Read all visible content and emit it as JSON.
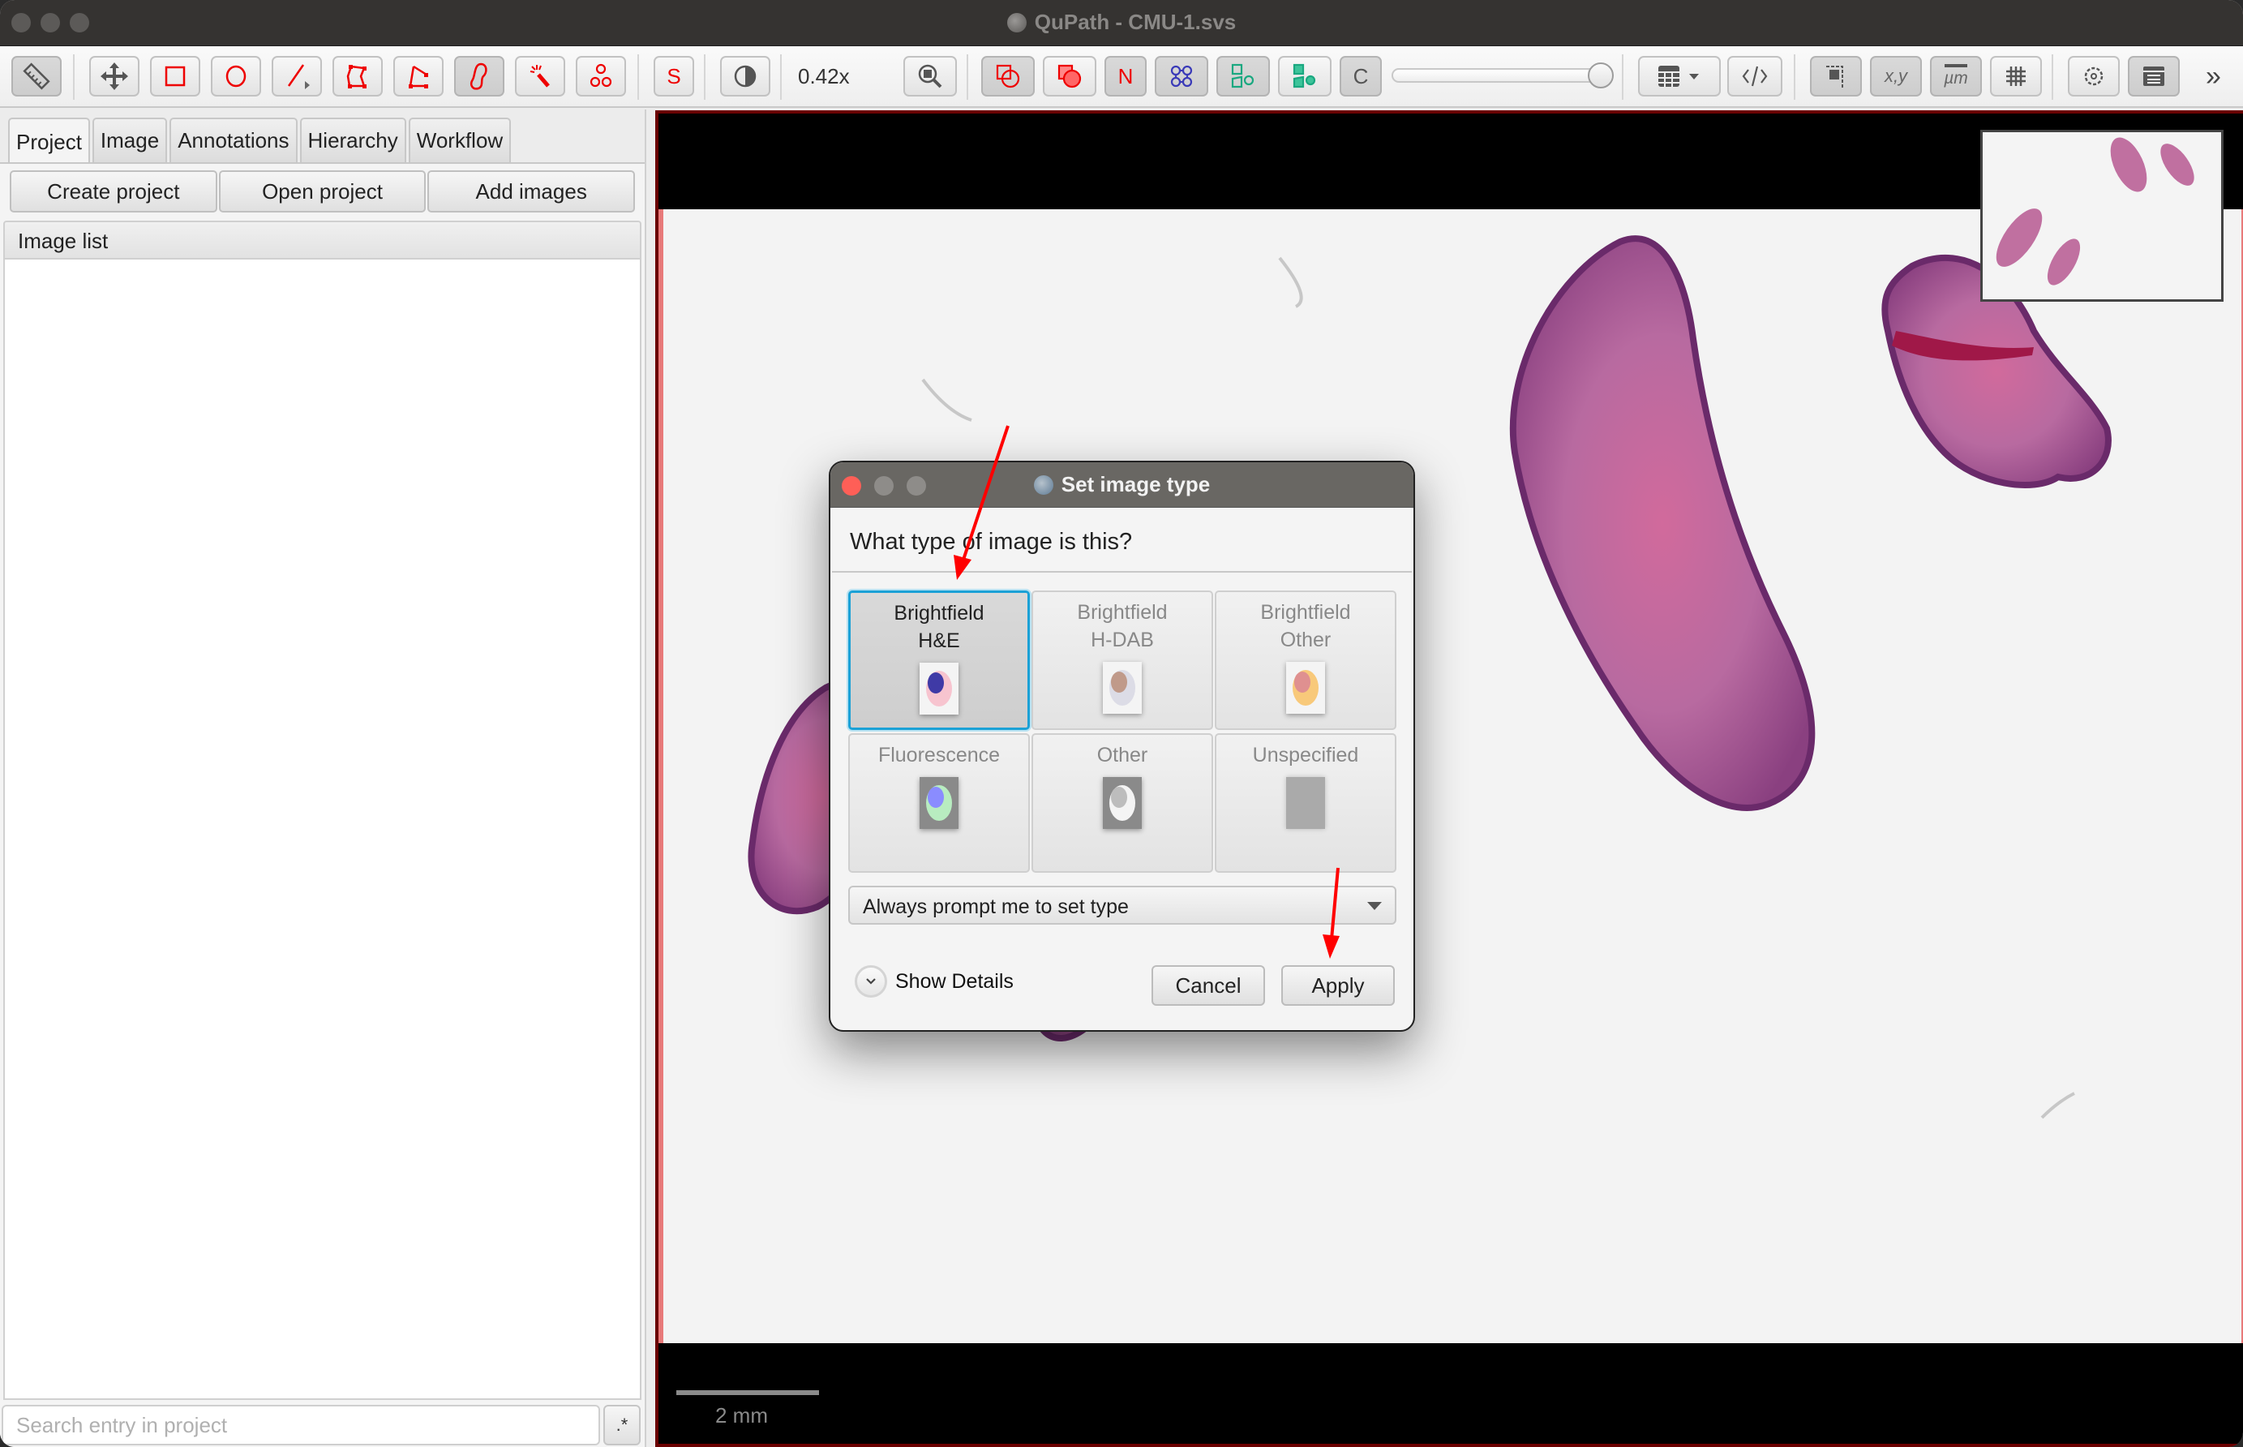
{
  "window": {
    "title": "QuPath - CMU-1.svs",
    "app_icon": "qupath-icon",
    "traffic_lights": [
      "close",
      "minimize",
      "zoom"
    ]
  },
  "toolbar": {
    "tools": [
      {
        "name": "measure-tool",
        "icon": "ruler-icon",
        "active": true
      },
      {
        "name": "move-tool",
        "icon": "move-arrows-icon",
        "active": false
      },
      {
        "name": "rectangle-tool",
        "icon": "rectangle-icon",
        "active": false
      },
      {
        "name": "ellipse-tool",
        "icon": "ellipse-icon",
        "active": false
      },
      {
        "name": "line-tool",
        "icon": "line-icon",
        "active": false
      },
      {
        "name": "polygon-tool",
        "icon": "polygon-icon",
        "active": false
      },
      {
        "name": "polyline-tool",
        "icon": "polyline-icon",
        "active": false
      },
      {
        "name": "brush-tool",
        "icon": "brush-icon",
        "active": true
      },
      {
        "name": "wand-tool",
        "icon": "wand-icon",
        "active": false
      },
      {
        "name": "points-tool",
        "icon": "points-icon",
        "active": false
      }
    ],
    "selection_mode_label": "S",
    "brightness_contrast_icon": "contrast-icon",
    "zoom_level": "0.42x",
    "zoom_to_fit_icon": "zoom-fit-icon",
    "overlay_toggles": [
      {
        "name": "show-annotations",
        "icon": "annotations-icon",
        "active": true
      },
      {
        "name": "fill-annotations",
        "icon": "fill-annotations-icon",
        "active": false
      },
      {
        "name": "show-names",
        "label": "N",
        "active": true
      },
      {
        "name": "show-tma-grid",
        "icon": "tma-grid-icon",
        "active": true
      },
      {
        "name": "show-detections",
        "icon": "detections-icon",
        "active": true
      },
      {
        "name": "fill-detections",
        "icon": "fill-detections-icon",
        "active": false
      },
      {
        "name": "show-connections",
        "label": "C",
        "active": true
      }
    ],
    "opacity_slider_value": 1.0,
    "measurement_table_icon": "table-icon",
    "script_editor_icon": "code-icon",
    "view_toggles": [
      {
        "name": "show-overview",
        "icon": "overview-icon",
        "active": true
      },
      {
        "name": "show-cursor-location",
        "label": "x,y",
        "active": true
      },
      {
        "name": "show-scalebar",
        "label": "µm",
        "active": true
      },
      {
        "name": "show-grid",
        "icon": "grid-icon",
        "active": false
      }
    ],
    "preferences_icon": "gear-icon",
    "log_icon": "log-icon",
    "overflow_label": "»"
  },
  "left_panel": {
    "tabs": [
      {
        "label": "Project",
        "active": true
      },
      {
        "label": "Image",
        "active": false
      },
      {
        "label": "Annotations",
        "active": false
      },
      {
        "label": "Hierarchy",
        "active": false
      },
      {
        "label": "Workflow",
        "active": false
      }
    ],
    "buttons": {
      "create_project": "Create project",
      "open_project": "Open project",
      "add_images": "Add images"
    },
    "image_list_header": "Image list",
    "image_list_items": [],
    "search": {
      "value": "",
      "placeholder": "Search entry in project"
    },
    "regex_toggle_label": ".*"
  },
  "viewer": {
    "scalebar_label": "2 mm",
    "colors": {
      "viewer_border": "#6a0000",
      "slide_border": "#e87a7a",
      "background": "#f3f3f3"
    }
  },
  "dialog": {
    "title": "Set image type",
    "question": "What type of image is this?",
    "image_types": [
      {
        "id": "brightfield-he",
        "line1": "Brightfield",
        "line2": "H&E",
        "selected": true,
        "icon": "he-cell-icon",
        "bg": "#f4f4f4",
        "outer": "#f7c4cf",
        "inner": "#3f3aa6"
      },
      {
        "id": "brightfield-hdab",
        "line1": "Brightfield",
        "line2": "H-DAB",
        "selected": false,
        "icon": "hdab-cell-icon",
        "bg": "#f4f4f4",
        "outer": "#dcdce6",
        "inner": "#c09a8a"
      },
      {
        "id": "brightfield-other",
        "line1": "Brightfield",
        "line2": "Other",
        "selected": false,
        "icon": "brightfield-other-cell-icon",
        "bg": "#f4f4f4",
        "outer": "#f8c97a",
        "inner": "#df9090"
      },
      {
        "id": "fluorescence",
        "line1": "Fluorescence",
        "line2": "",
        "selected": false,
        "icon": "fluorescence-cell-icon",
        "bg": "#8a8a8a",
        "outer": "#b8ecc0",
        "inner": "#8a8cff"
      },
      {
        "id": "other",
        "line1": "Other",
        "line2": "",
        "selected": false,
        "icon": "other-cell-icon",
        "bg": "#8a8a8a",
        "outer": "#f4f4f4",
        "inner": "#bdbdbd"
      },
      {
        "id": "unspecified",
        "line1": "Unspecified",
        "line2": "",
        "selected": false,
        "icon": "unspecified-icon",
        "bg": "#aaaaaa",
        "outer": "",
        "inner": ""
      }
    ],
    "prompt_setting": {
      "selected": "Always prompt me to set type"
    },
    "show_details_label": "Show Details",
    "cancel_label": "Cancel",
    "apply_label": "Apply",
    "selection_color": "#1ba1d6"
  },
  "annotations": {
    "arrows": [
      {
        "target": "brightfield-he-option",
        "color": "#ff0000"
      },
      {
        "target": "apply-button",
        "color": "#ff0000"
      }
    ]
  }
}
